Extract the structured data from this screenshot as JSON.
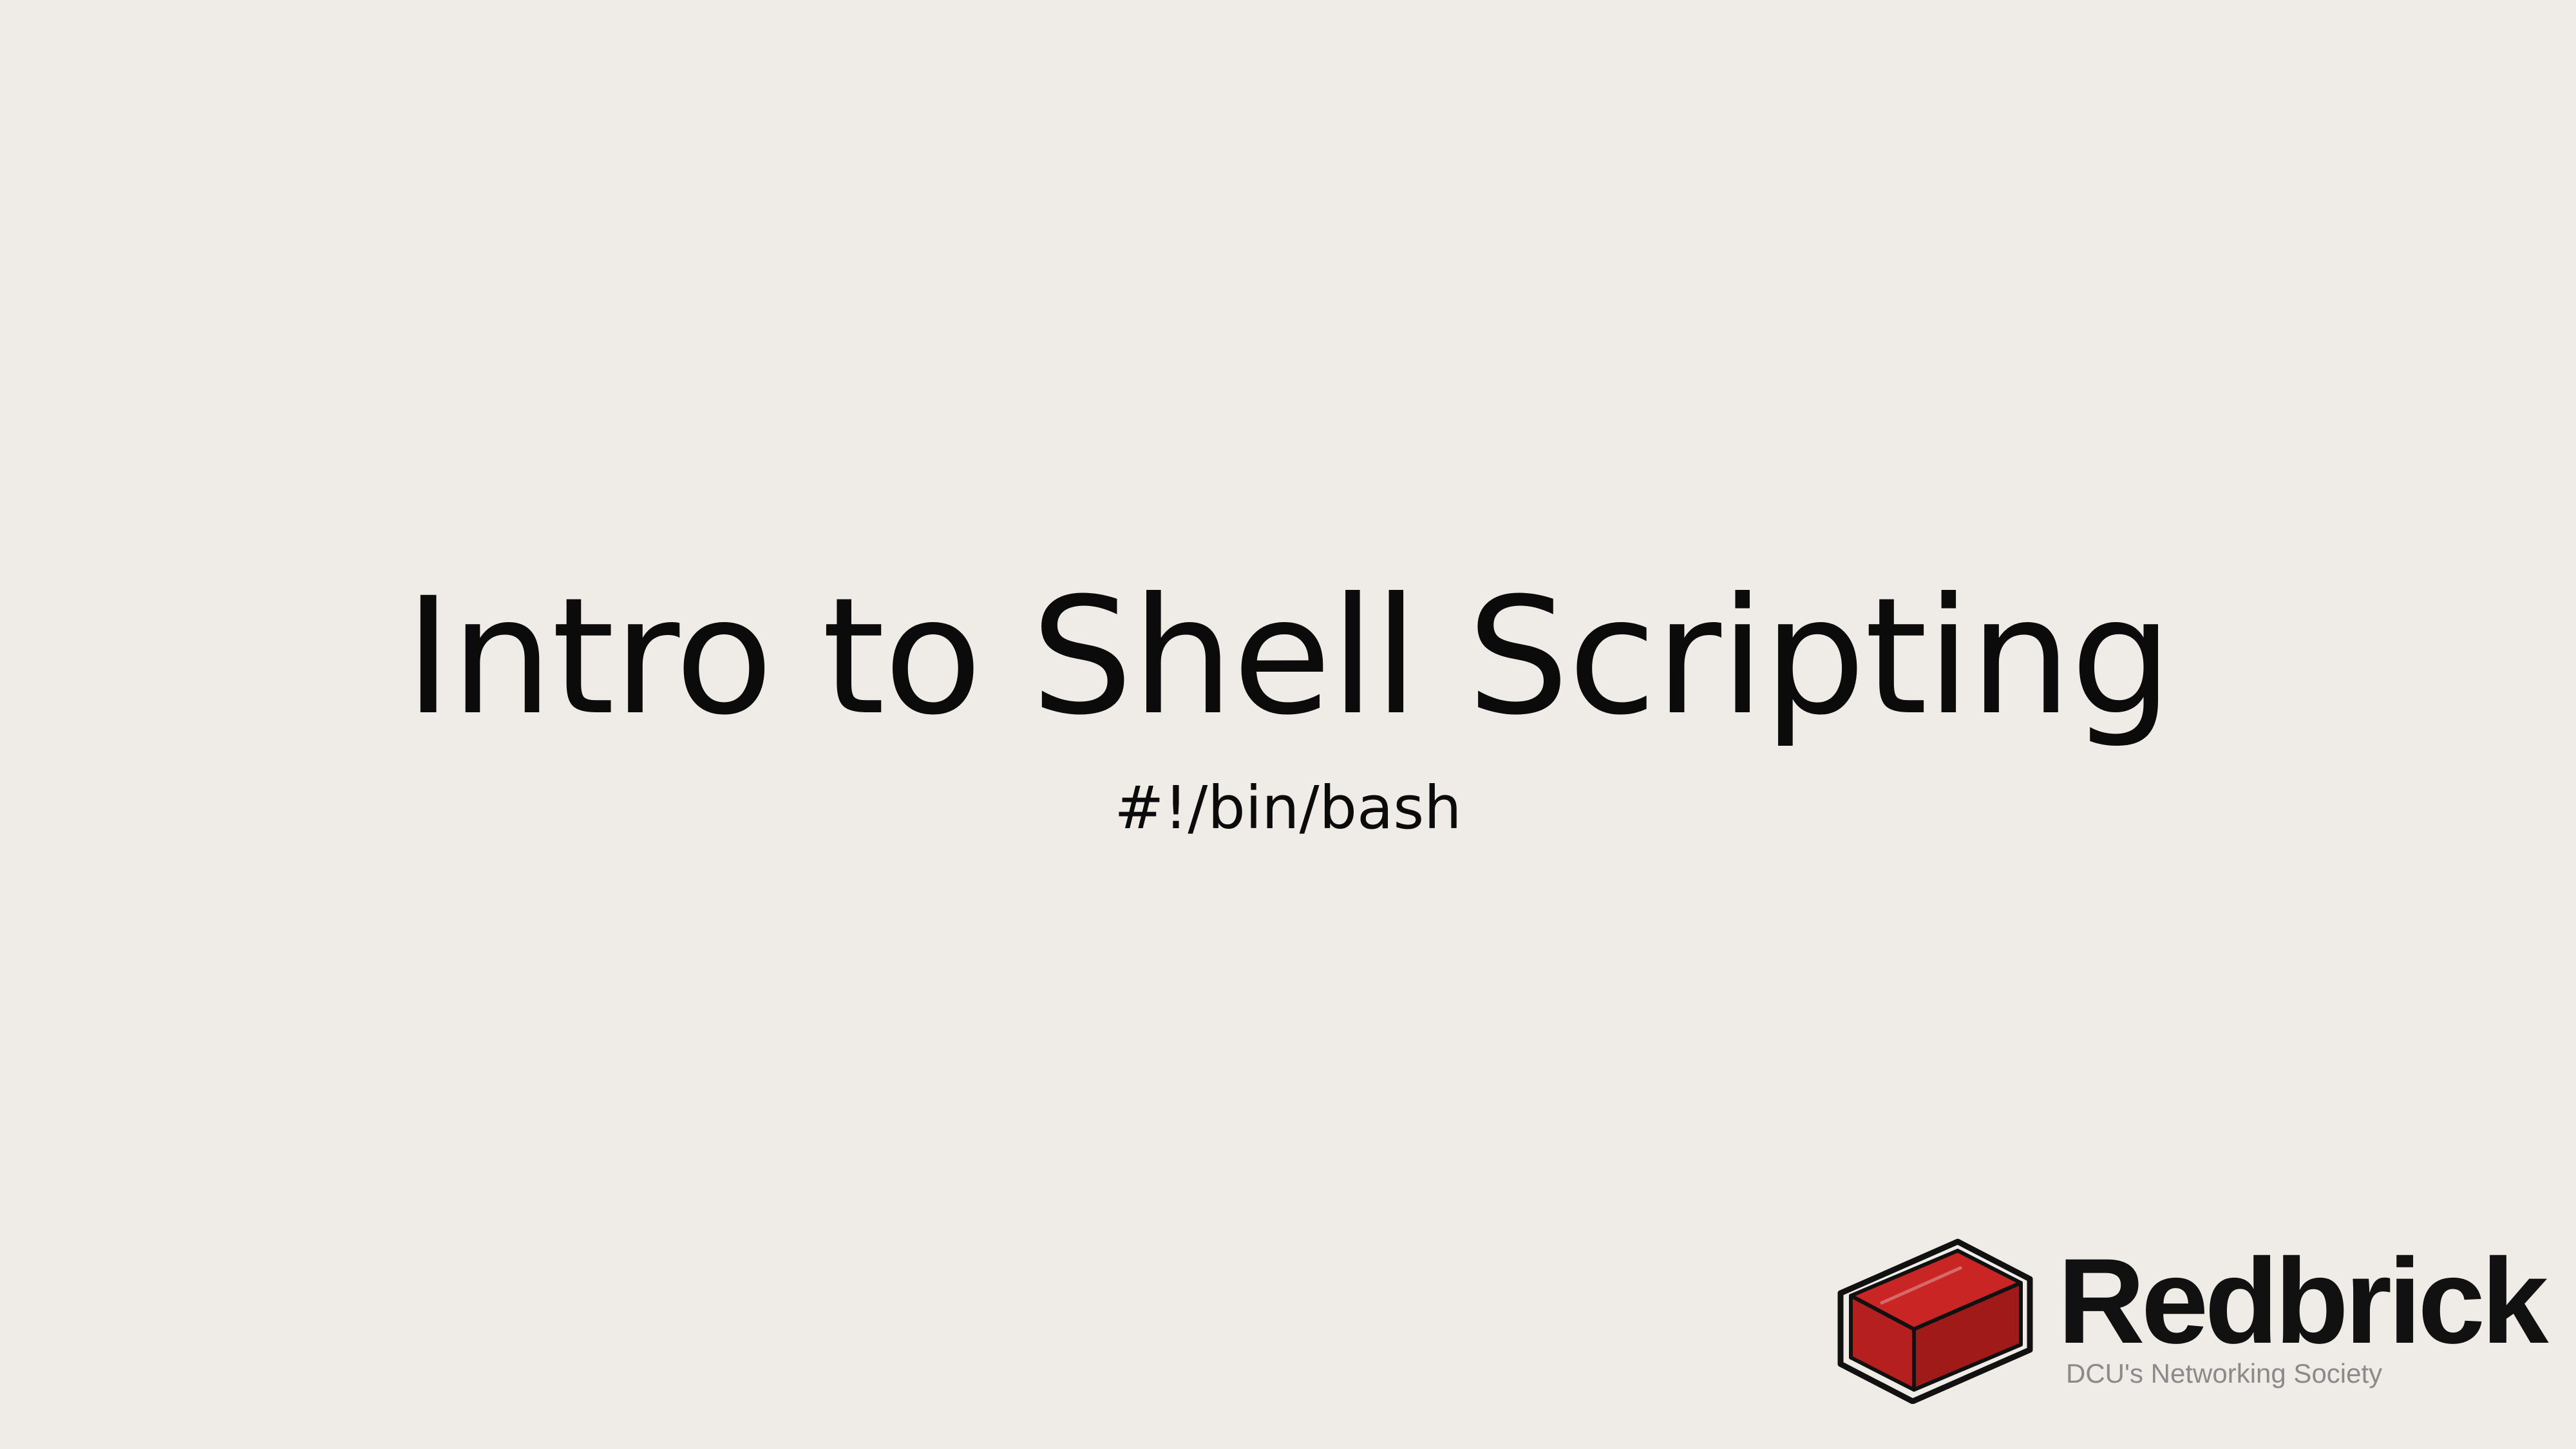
{
  "slide": {
    "title": "Intro to Shell Scripting",
    "subtitle": "#!/bin/bash"
  },
  "logo": {
    "name": "Redbrick",
    "tagline": "DCU's Networking Society",
    "icon": "red-brick-icon",
    "colors": {
      "brick_front": "#b51f1f",
      "brick_top": "#c92525",
      "brick_side": "#8c1414",
      "outline": "#111111"
    }
  },
  "colors": {
    "background": "#efebe7",
    "text": "#0b0b0b"
  }
}
